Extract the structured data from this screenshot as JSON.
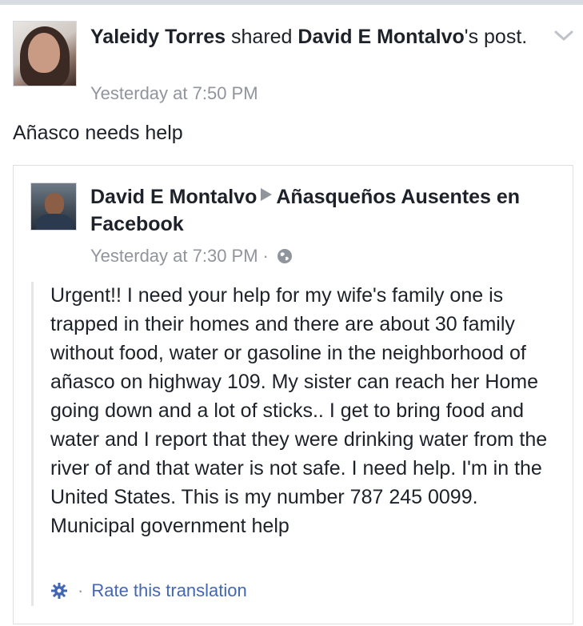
{
  "sharer": {
    "name": "Yaleidy Torres",
    "shared_text": " shared ",
    "original_author": "David E Montalvo",
    "post_suffix": "'s post.",
    "time": "Yesterday at 7:50 PM"
  },
  "caption": "Añasco needs help",
  "original_post": {
    "author": "David E Montalvo",
    "group": "Añasqueños Ausentes en Facebook",
    "time": "Yesterday at 7:30 PM",
    "dot": "·",
    "body": "Urgent!! I need your help for my wife's family one is trapped in their homes and there are about 30 family without food, water or gasoline in the neighborhood of añasco on highway 109. My sister can reach her Home going down and a lot of sticks.. I get to bring food and water and I report that they were drinking water from the river of and that water is not safe. I need help. I'm in the United States. This is my number 787 245 0099. Municipal government help",
    "translation_dot": "·",
    "rate_translation": "Rate this translation"
  },
  "icons": {
    "chevron": "chevron-down-icon",
    "globe": "globe-icon",
    "gear": "gear-icon",
    "arrow": "triangle-right-icon"
  },
  "colors": {
    "text": "#1d2129",
    "meta": "#90949c",
    "link": "#4267b2",
    "border": "#dddfe2"
  }
}
